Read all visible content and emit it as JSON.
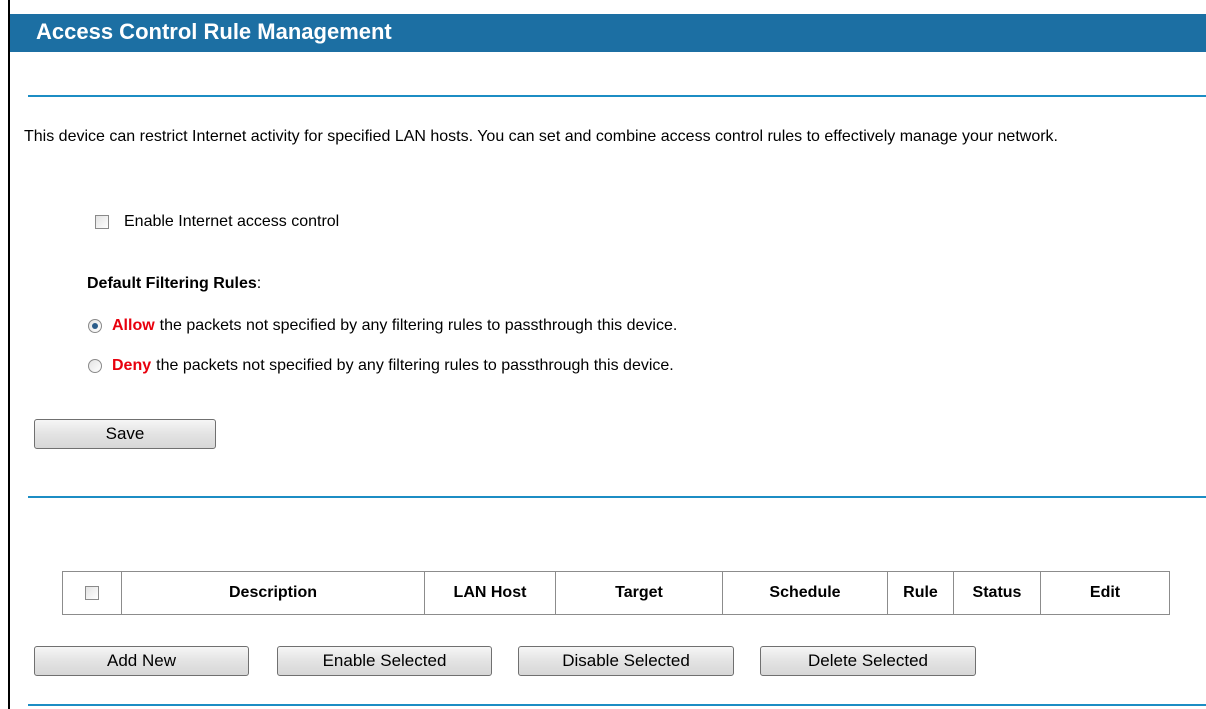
{
  "header": {
    "title": "Access Control Rule Management"
  },
  "intro": {
    "text": "This device can restrict Internet activity for specified LAN hosts. You can set and combine access control rules to effectively manage your network."
  },
  "enable_control": {
    "label": "Enable Internet access control",
    "checked": false
  },
  "default_filtering": {
    "heading": "Default Filtering Rules",
    "heading_suffix": ":",
    "options": [
      {
        "keyword": "Allow",
        "text": "the packets not specified by any filtering rules to passthrough this device.",
        "selected": true
      },
      {
        "keyword": "Deny",
        "text": "the packets not specified by any filtering rules to passthrough this device.",
        "selected": false
      }
    ],
    "keyword_color": "#e8000d"
  },
  "save_button": {
    "label": "Save"
  },
  "table": {
    "columns": [
      "Description",
      "LAN Host",
      "Target",
      "Schedule",
      "Rule",
      "Status",
      "Edit"
    ],
    "rows": []
  },
  "actions": {
    "add_new": "Add New",
    "enable_selected": "Enable Selected",
    "disable_selected": "Disable Selected",
    "delete_selected": "Delete Selected"
  },
  "colors": {
    "title_bar": "#1c6fa3",
    "divider": "#1c8dc4"
  }
}
